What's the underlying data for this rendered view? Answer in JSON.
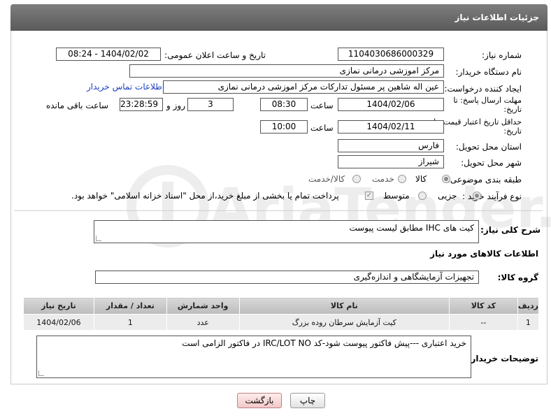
{
  "header": {
    "title": "جزئیات اطلاعات نیاز"
  },
  "fields": {
    "need_number": {
      "label": "شماره نیاز:",
      "value": "1104030686000329"
    },
    "announce_datetime": {
      "label": "تاریخ و ساعت اعلان عمومی:",
      "value": "1404/02/02 - 08:24"
    },
    "buyer_org": {
      "label": "نام دستگاه خریدار:",
      "value": "مرکز اموزشی درمانی نمازی"
    },
    "requester": {
      "label": "ایجاد کننده درخواست:",
      "value": "عین اله شاهین پر مسئول تدارکات مرکز اموزشی درمانی نمازی"
    },
    "buyer_contact_link": "اطلاعات تماس خریدار",
    "reply_deadline": {
      "label": "مهلت ارسال پاسخ: تا تاریخ:",
      "date": "1404/02/06",
      "time_label": "ساعت",
      "time": "08:30",
      "days": "3",
      "days_label": "روز و",
      "remaining": "23:28:59",
      "remaining_label": "ساعت باقی مانده"
    },
    "price_validity": {
      "label": "حداقل تاریخ اعتبار قیمت: تا تاریخ:",
      "date": "1404/02/11",
      "time_label": "ساعت",
      "time": "10:00"
    },
    "delivery_province": {
      "label": "استان محل تحویل:",
      "value": "فارس"
    },
    "delivery_city": {
      "label": "شهر محل تحویل:",
      "value": "شیراز"
    },
    "category": {
      "label": "طبقه بندی موضوعی:",
      "options": [
        "کالا",
        "خدمت",
        "کالا/خدمت"
      ],
      "selected": 0
    },
    "purchase_process": {
      "label": "نوع فرآیند خرید :",
      "options": [
        "جزیی",
        "متوسط"
      ],
      "selected": 0,
      "payment_note": "پرداخت تمام یا بخشی از مبلغ خرید،از محل \"اسناد خزانه اسلامی\" خواهد بود."
    }
  },
  "description": {
    "label": "شرح کلی نیاز:",
    "value": "کیت های IHC  مطابق لیست پیوست"
  },
  "goods_section": {
    "title": "اطلاعات کالاهای مورد نیاز",
    "group_label": "گروه کالا:",
    "group_value": "تجهیزات آزمایشگاهی و اندازه‌گیری"
  },
  "table": {
    "headers": [
      "ردیف",
      "کد کالا",
      "نام کالا",
      "واحد شمارش",
      "تعداد / مقدار",
      "تاریخ نیاز"
    ],
    "rows": [
      [
        "1",
        "--",
        "کیت آزمایش سرطان روده بزرگ",
        "عدد",
        "1",
        "1404/02/06"
      ]
    ]
  },
  "buyer_notes": {
    "label": "توضیحات خریدار:",
    "value": "خرید اعتباری ---پیش فاکتور پیوست شود-کد  IRC/LOT NO  در فاکتور الزامی است"
  },
  "buttons": {
    "print": "چاپ",
    "back": "بازگشت"
  },
  "watermark": {
    "text": "AriaTender.net"
  },
  "colors": {
    "header_bg": "#6b6b6b",
    "link": "#1a3fbf",
    "back_button": "#f2c9c9"
  }
}
